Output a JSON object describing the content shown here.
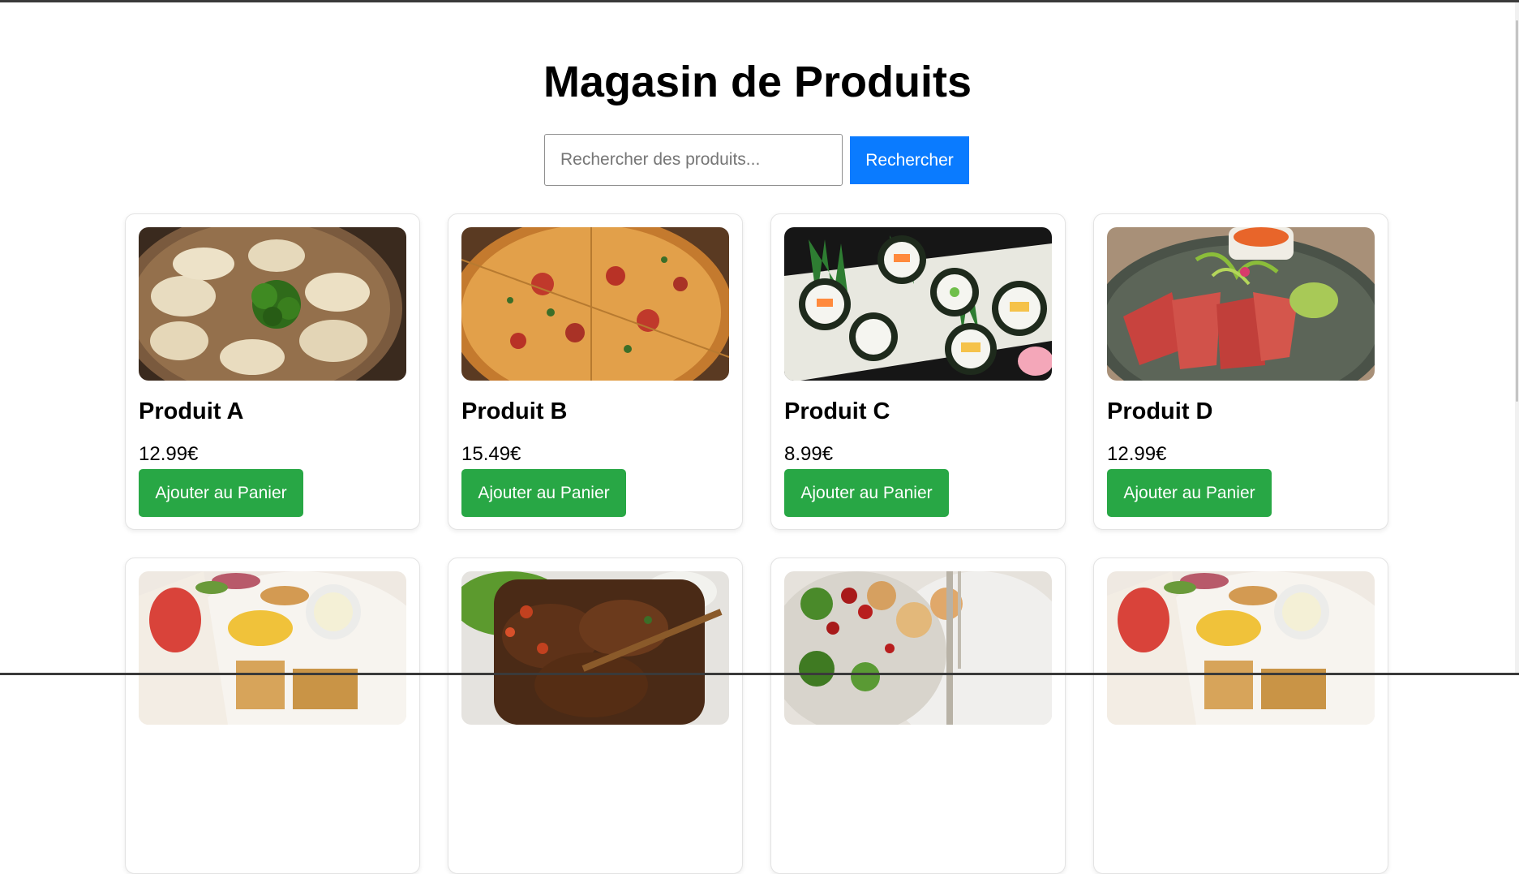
{
  "page": {
    "title": "Magasin de Produits"
  },
  "search": {
    "placeholder": "Rechercher des produits...",
    "value": "",
    "button_label": "Rechercher"
  },
  "products": [
    {
      "name": "Produit A",
      "price": "12.99€",
      "button_label": "Ajouter au Panier",
      "image": "dumplings-photo"
    },
    {
      "name": "Produit B",
      "price": "15.49€",
      "button_label": "Ajouter au Panier",
      "image": "pizza-photo"
    },
    {
      "name": "Produit C",
      "price": "8.99€",
      "button_label": "Ajouter au Panier",
      "image": "sushi-photo"
    },
    {
      "name": "Produit D",
      "price": "12.99€",
      "button_label": "Ajouter au Panier",
      "image": "tuna-tataki-photo"
    },
    {
      "image": "fish-and-chips-photo"
    },
    {
      "image": "grilled-ribs-photo"
    },
    {
      "image": "salad-bowl-photo"
    },
    {
      "image": "fish-and-chips-photo"
    }
  ],
  "colors": {
    "primary": "#0a7bff",
    "success": "#28a745",
    "border": "#e3e3e3"
  }
}
